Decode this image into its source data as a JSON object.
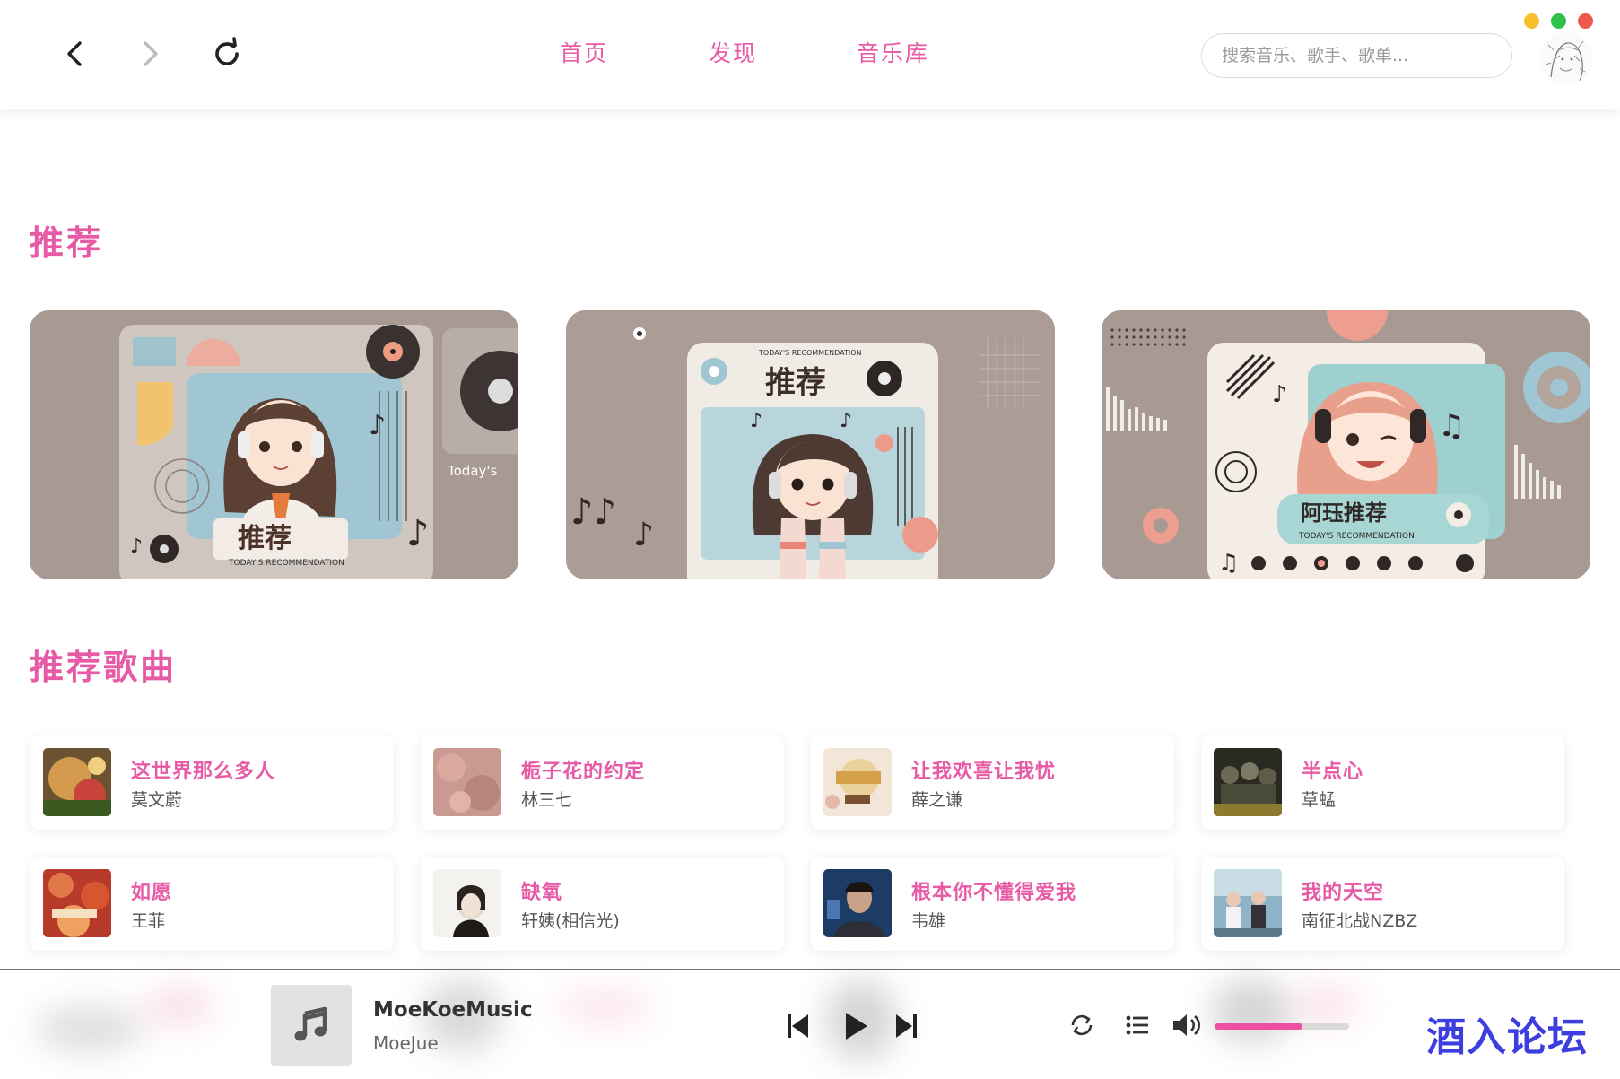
{
  "header": {
    "tabs": {
      "home": "首页",
      "discover": "发现",
      "library": "音乐库"
    },
    "search_placeholder": "搜索音乐、歌手、歌单..."
  },
  "sections": {
    "recommend_title": "推荐",
    "songs_title": "推荐歌曲"
  },
  "banners": [
    {
      "icon": "playlist-cover-image"
    },
    {
      "icon": "playlist-cover-image"
    },
    {
      "icon": "playlist-cover-image"
    }
  ],
  "songs": [
    {
      "name": "这世界那么多人",
      "artist": "莫文蔚"
    },
    {
      "name": "栀子花的约定",
      "artist": "林三七"
    },
    {
      "name": "让我欢喜让我忧",
      "artist": "薛之谦"
    },
    {
      "name": "半点心",
      "artist": "草蜢"
    },
    {
      "name": "如愿",
      "artist": "王菲"
    },
    {
      "name": "缺氧",
      "artist": "轩姨(相信光)"
    },
    {
      "name": "根本你不懂得爱我",
      "artist": "韦雄"
    },
    {
      "name": "我的天空",
      "artist": "南征北战NZBZ"
    }
  ],
  "player": {
    "title": "MoeKoeMusic",
    "artist": "MoeJue",
    "volume_fraction": 0.65
  },
  "watermark": "酒入论坛",
  "colors": {
    "accent": "#e75aa6",
    "volume": "#ee4fa0",
    "watermark": "#3c3ee0"
  }
}
